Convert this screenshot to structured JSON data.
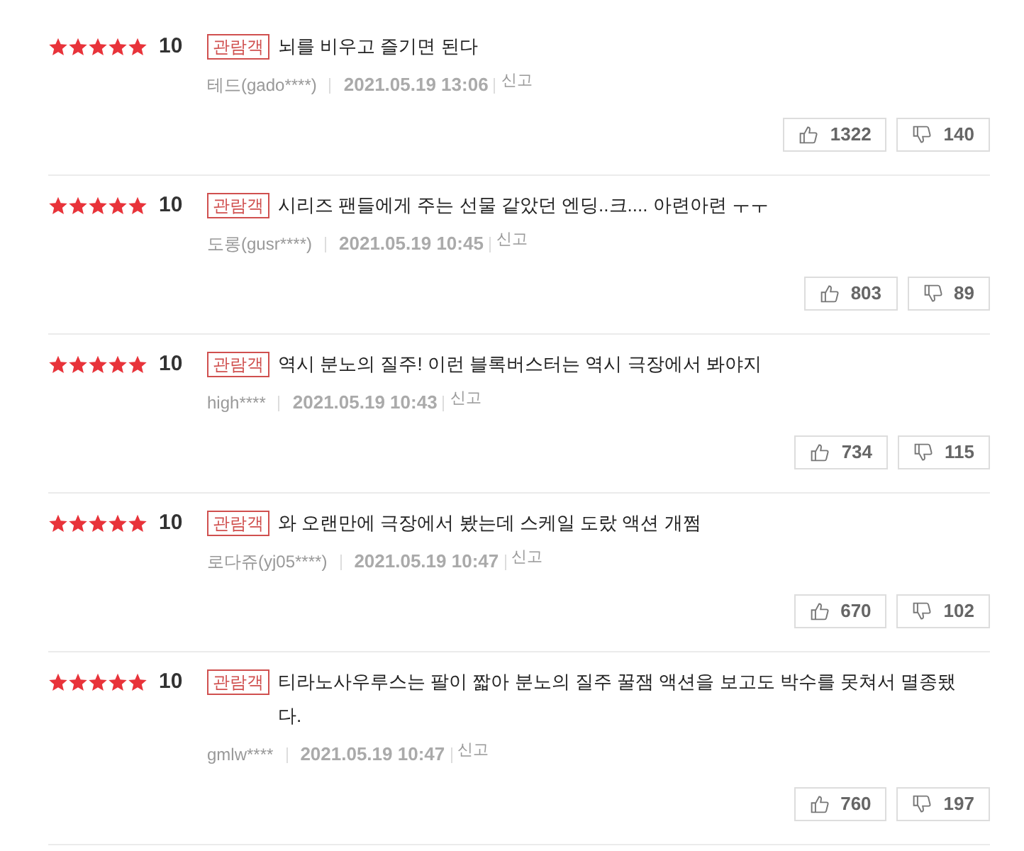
{
  "reviews": [
    {
      "stars": 5,
      "score": "10",
      "badge": "관람객",
      "text": "뇌를 비우고 즐기면 된다",
      "author": "테드(gado****)",
      "date": "2021.05.19 13:06",
      "report": "신고",
      "likes": "1322",
      "dislikes": "140"
    },
    {
      "stars": 5,
      "score": "10",
      "badge": "관람객",
      "text": "시리즈 팬들에게 주는 선물 같았던 엔딩..크.... 아련아련 ㅜㅜ",
      "author": "도롱(gusr****)",
      "date": "2021.05.19 10:45",
      "report": "신고",
      "likes": "803",
      "dislikes": "89"
    },
    {
      "stars": 5,
      "score": "10",
      "badge": "관람객",
      "text": "역시 분노의 질주! 이런 블록버스터는 역시 극장에서 봐야지",
      "author": "high****",
      "date": "2021.05.19 10:43",
      "report": "신고",
      "likes": "734",
      "dislikes": "115"
    },
    {
      "stars": 5,
      "score": "10",
      "badge": "관람객",
      "text": "와 오랜만에 극장에서 봤는데 스케일 도랐 액션 개쩜",
      "author": "로다쥬(yj05****)",
      "date": "2021.05.19 10:47",
      "report": "신고",
      "likes": "670",
      "dislikes": "102"
    },
    {
      "stars": 5,
      "score": "10",
      "badge": "관람객",
      "text": "티라노사우루스는 팔이 짧아 분노의 질주 꿀잼 액션을 보고도 박수를 못쳐서 멸종됐다.",
      "author": "gmlw****",
      "date": "2021.05.19 10:47",
      "report": "신고",
      "likes": "760",
      "dislikes": "197"
    }
  ]
}
